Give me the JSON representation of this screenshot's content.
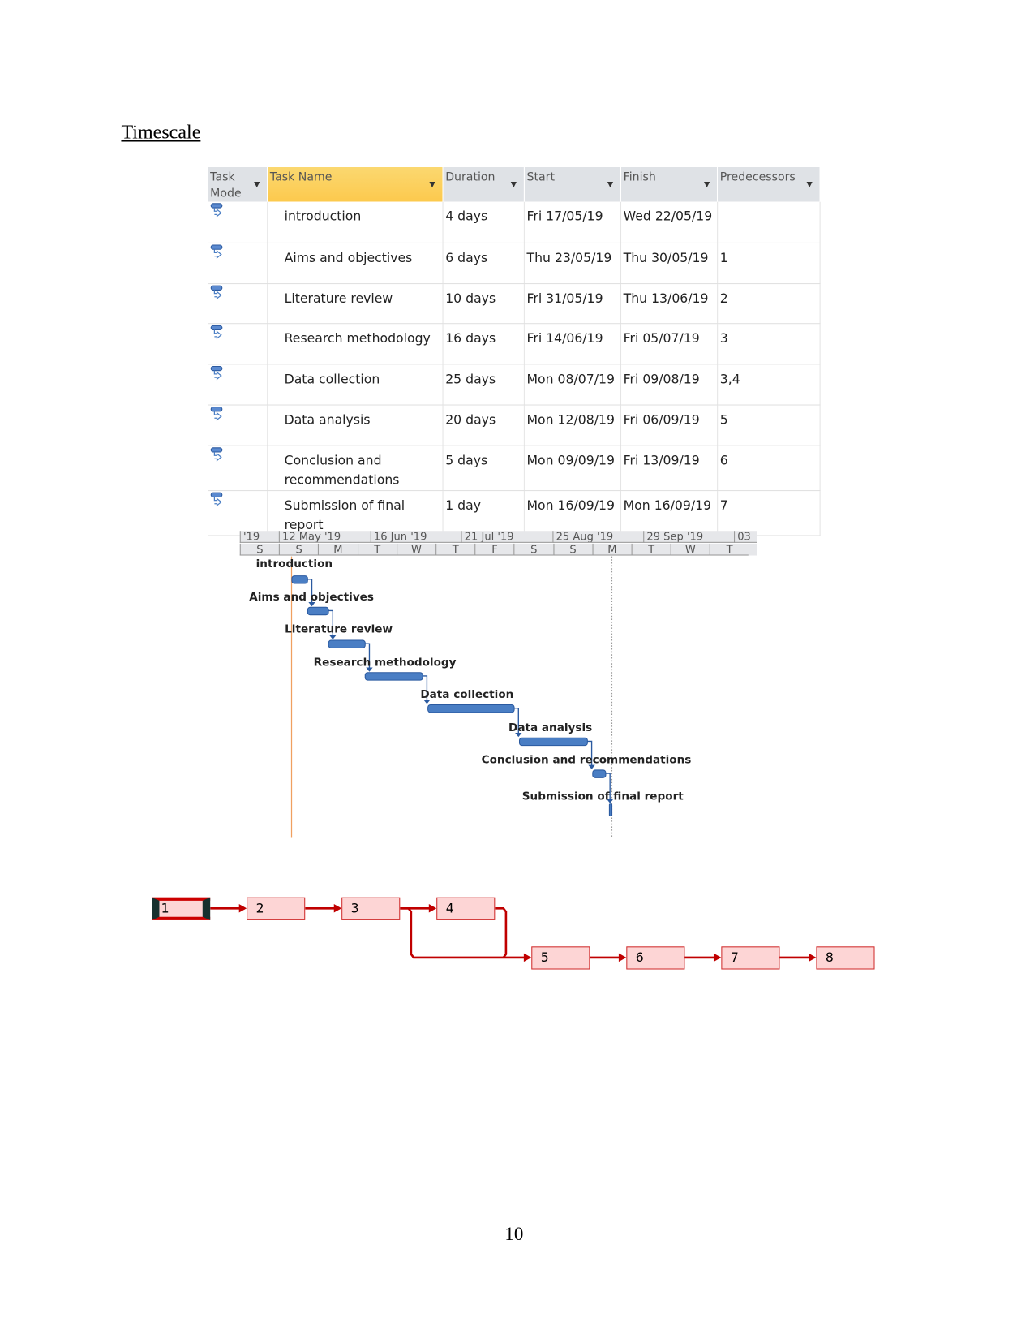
{
  "heading": "Timescale",
  "page_number": "10",
  "table": {
    "headers": {
      "mode": "Task Mode",
      "name": "Task Name",
      "duration": "Duration",
      "start": "Start",
      "finish": "Finish",
      "predecessors": "Predecessors"
    },
    "rows": [
      {
        "name": "introduction",
        "duration": "4 days",
        "start": "Fri 17/05/19",
        "finish": "Wed 22/05/19",
        "predecessors": ""
      },
      {
        "name": "Aims and objectives",
        "duration": "6 days",
        "start": "Thu 23/05/19",
        "finish": "Thu 30/05/19",
        "predecessors": "1"
      },
      {
        "name": "Literature review",
        "duration": "10 days",
        "start": "Fri 31/05/19",
        "finish": "Thu 13/06/19",
        "predecessors": "2"
      },
      {
        "name": "Research methodology",
        "duration": "16 days",
        "start": "Fri 14/06/19",
        "finish": "Fri 05/07/19",
        "predecessors": "3"
      },
      {
        "name": "Data collection",
        "duration": "25 days",
        "start": "Mon 08/07/19",
        "finish": "Fri 09/08/19",
        "predecessors": "3,4"
      },
      {
        "name": "Data analysis",
        "duration": "20 days",
        "start": "Mon 12/08/19",
        "finish": "Fri 06/09/19",
        "predecessors": "5"
      },
      {
        "name": "Conclusion and recommendations",
        "duration": "5 days",
        "start": "Mon 09/09/19",
        "finish": "Fri 13/09/19",
        "predecessors": "6"
      },
      {
        "name": "Submission of final report",
        "duration": "1 day",
        "start": "Mon 16/09/19",
        "finish": "Mon 16/09/19",
        "predecessors": "7"
      }
    ]
  },
  "timescale": {
    "top": [
      "'19",
      "12 May '19",
      "16 Jun '19",
      "21 Jul '19",
      "25 Aug '19",
      "29 Sep '19",
      "03"
    ],
    "bottom": [
      "S",
      "S",
      "M",
      "T",
      "W",
      "T",
      "F",
      "S",
      "S",
      "M",
      "T",
      "W",
      "T"
    ]
  },
  "gantt": {
    "bar_color": "#4a7ec4",
    "today_line_color": "#f0a060",
    "tasks": [
      {
        "label": "introduction",
        "start": "2019-05-17",
        "finish": "2019-05-22"
      },
      {
        "label": "Aims and objectives",
        "start": "2019-05-23",
        "finish": "2019-05-30"
      },
      {
        "label": "Literature review",
        "start": "2019-05-31",
        "finish": "2019-06-13"
      },
      {
        "label": "Research methodology",
        "start": "2019-06-14",
        "finish": "2019-07-05"
      },
      {
        "label": "Data collection",
        "start": "2019-07-08",
        "finish": "2019-08-09"
      },
      {
        "label": "Data analysis",
        "start": "2019-08-12",
        "finish": "2019-09-06"
      },
      {
        "label": "Conclusion and recommendations",
        "start": "2019-09-09",
        "finish": "2019-09-13"
      },
      {
        "label": "Submission of final report",
        "start": "2019-09-16",
        "finish": "2019-09-16"
      }
    ]
  },
  "network": {
    "line_color": "#c00000",
    "nodes": [
      "1",
      "2",
      "3",
      "4",
      "5",
      "6",
      "7",
      "8"
    ]
  }
}
